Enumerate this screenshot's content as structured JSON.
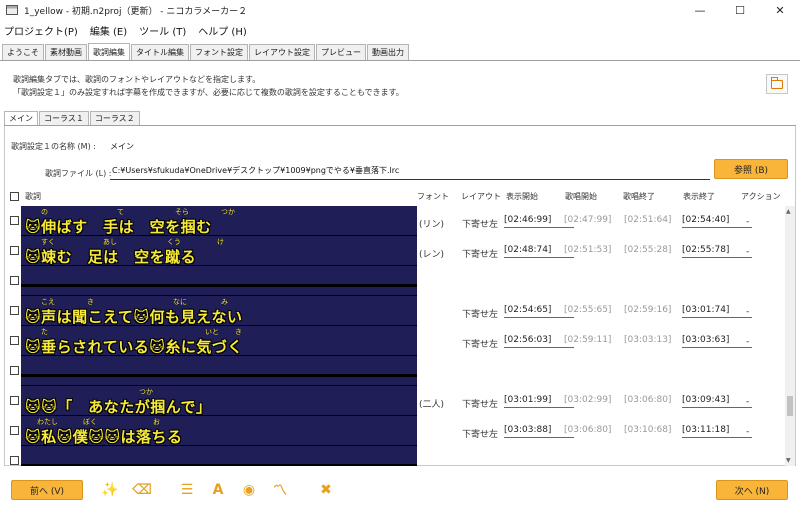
{
  "window": {
    "title": "1_yellow - 初期.n2proj（更新） - ニコカラメーカー２",
    "minimize": "—",
    "maximize": "☐",
    "close": "✕"
  },
  "menu": [
    "プロジェクト(P)",
    "編集 (E)",
    "ツール (T)",
    "ヘルプ (H)"
  ],
  "tabs": [
    "ようこそ",
    "素材動画",
    "歌詞編集",
    "タイトル編集",
    "フォント設定",
    "レイアウト設定",
    "プレビュー",
    "動画出力"
  ],
  "info": {
    "line1": "歌詞編集タブでは、歌詞のフォントやレイアウトなどを指定します。",
    "line2": "「歌詞設定１」のみ設定すれば字幕を作成できますが、必要に応じて複数の歌詞を設定することもできます。"
  },
  "subtabs": [
    "メイン",
    "コーラス１",
    "コーラス２"
  ],
  "settings": {
    "name_label": "歌詞設定１の名称 (M) :",
    "name_value": "メイン",
    "file_label": "歌詞ファイル (L) :",
    "file_value": "C:¥Users¥sfukuda¥OneDrive¥デスクトップ¥1009¥pngでやる¥垂直落下.lrc",
    "browse_label": "参照 (B)"
  },
  "table": {
    "headers": {
      "lyric": "歌詞",
      "font": "フォント",
      "layout": "レイアウト",
      "show_start": "表示開始",
      "sing_start": "歌唱開始",
      "sing_end": "歌唱終了",
      "show_end": "表示終了",
      "action": "アクション"
    },
    "rows": [
      {
        "lyric": "🐱伸ばす　手は　空を掴む",
        "ruby": [
          [
            "の",
            16
          ],
          [
            "て",
            92
          ],
          [
            "そら",
            150
          ],
          [
            "つか",
            196
          ]
        ],
        "font": "(リン)",
        "layout": "下寄せ左",
        "show_start": "[02:46:99]",
        "sing_start": "[02:47:99]",
        "sing_end": "[02:51:64]",
        "show_end": "[02:54:40]",
        "action": "-"
      },
      {
        "lyric": "🐱竦む　足は　空を蹴る",
        "ruby": [
          [
            "すく",
            16
          ],
          [
            "あし",
            78
          ],
          [
            "くう",
            142
          ],
          [
            "け",
            192
          ]
        ],
        "font": "(レン)",
        "layout": "下寄せ左",
        "show_start": "[02:48:74]",
        "sing_start": "[02:51:53]",
        "sing_end": "[02:55:28]",
        "show_end": "[02:55:78]",
        "action": "-"
      },
      {
        "lyric": "",
        "ruby": [],
        "font": "",
        "layout": "",
        "show_start": "",
        "sing_start": "",
        "sing_end": "",
        "show_end": "",
        "action": "",
        "empty": true
      },
      {
        "lyric": "🐱声は聞こえて🐱何も見えない",
        "ruby": [
          [
            "こえ",
            16
          ],
          [
            "き",
            62
          ],
          [
            "なに",
            148
          ],
          [
            "み",
            196
          ]
        ],
        "font": "",
        "layout": "下寄せ左",
        "show_start": "[02:54:65]",
        "sing_start": "[02:55:65]",
        "sing_end": "[02:59:16]",
        "show_end": "[03:01:74]",
        "action": "-"
      },
      {
        "lyric": "🐱垂らされている🐱糸に気づく",
        "ruby": [
          [
            "た",
            16
          ],
          [
            "いと",
            180
          ],
          [
            "き",
            210
          ]
        ],
        "font": "",
        "layout": "下寄せ左",
        "show_start": "[02:56:03]",
        "sing_start": "[02:59:11]",
        "sing_end": "[03:03:13]",
        "show_end": "[03:03:63]",
        "action": "-"
      },
      {
        "lyric": "",
        "ruby": [],
        "font": "",
        "layout": "",
        "show_start": "",
        "sing_start": "",
        "sing_end": "",
        "show_end": "",
        "action": "",
        "empty": true
      },
      {
        "lyric": "🐱🐱「　あなたが掴んで」",
        "ruby": [
          [
            "つか",
            114
          ]
        ],
        "font": "(二人)",
        "layout": "下寄せ左",
        "show_start": "[03:01:99]",
        "sing_start": "[03:02:99]",
        "sing_end": "[03:06:80]",
        "show_end": "[03:09:43]",
        "action": "-"
      },
      {
        "lyric": "🐱私🐱僕🐱🐱は落ちる",
        "ruby": [
          [
            "わたし",
            12
          ],
          [
            "ぼく",
            58
          ],
          [
            "お",
            128
          ]
        ],
        "font": "",
        "layout": "下寄せ左",
        "show_start": "[03:03:88]",
        "sing_start": "[03:06:80]",
        "sing_end": "[03:10:68]",
        "show_end": "[03:11:18]",
        "action": "-"
      },
      {
        "lyric": "",
        "ruby": [],
        "font": "",
        "layout": "",
        "show_start": "",
        "sing_start": "",
        "sing_end": "",
        "show_end": "",
        "action": "",
        "empty": true
      }
    ]
  },
  "footer": {
    "prev_label": "前へ (V)",
    "next_label": "次へ (N)",
    "tools": [
      {
        "icon": "magic-wand-icon",
        "glyph": "✨"
      },
      {
        "icon": "eraser-icon",
        "glyph": "⌫"
      },
      {
        "icon": "list-icon",
        "glyph": "☰"
      },
      {
        "icon": "font-size-icon",
        "glyph": "A"
      },
      {
        "icon": "eye-icon",
        "glyph": "◉"
      },
      {
        "icon": "chart-line-icon",
        "glyph": "〽"
      },
      {
        "icon": "tools-icon",
        "glyph": "✖"
      }
    ]
  },
  "colors": {
    "accent": "#f8b53a",
    "lyric_bg": "#1f1e57",
    "lyric_text": "#f8ea3a"
  }
}
